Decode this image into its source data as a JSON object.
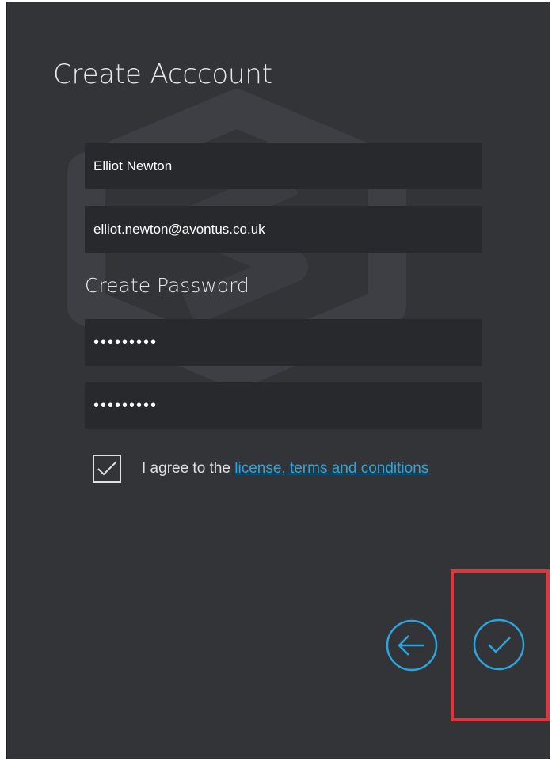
{
  "page": {
    "title": "Create Acccount"
  },
  "form": {
    "name_value": "Elliot Newton",
    "email_value": "elliot.newton@avontus.co.uk",
    "password_section_label": "Create Password",
    "password_value": "•••••••••",
    "confirm_password_value": "•••••••••",
    "agree": {
      "checked": true,
      "prefix": "I agree to the ",
      "link_text": "license, terms and conditions"
    }
  },
  "actions": {
    "back_icon": "arrow-left-circle-icon",
    "confirm_icon": "checkmark-circle-icon"
  },
  "colors": {
    "background": "#333438",
    "field_background": "#28292c",
    "accent": "#2aa6df",
    "highlight": "#e3333b",
    "text": "#e8e8e8"
  }
}
